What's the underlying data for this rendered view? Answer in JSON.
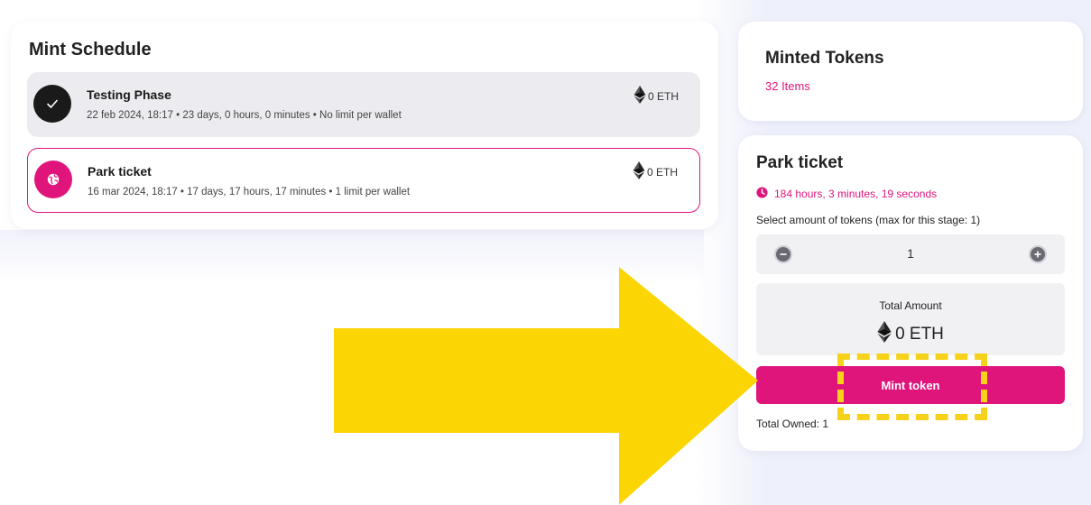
{
  "schedule": {
    "title": "Mint Schedule",
    "phases": [
      {
        "name": "Testing Phase",
        "meta": "22 feb 2024, 18:17  •  23 days, 0 hours, 0 minutes  •  No limit per wallet",
        "price": "0 ETH",
        "icon": "check-icon"
      },
      {
        "name": "Park ticket",
        "meta": "16 mar 2024, 18:17  •  17 days, 17 hours, 17 minutes  •  1 limit per wallet",
        "price": "0 ETH",
        "icon": "globe-icon"
      }
    ]
  },
  "minted": {
    "title": "Minted Tokens",
    "count": "32 Items"
  },
  "ticket": {
    "title": "Park ticket",
    "countdown": "184 hours, 3 minutes, 19 seconds",
    "select_label": "Select amount of tokens (max for this stage: 1)",
    "quantity": "1",
    "total_label": "Total Amount",
    "total_value": "0 ETH",
    "mint_label": "Mint token",
    "owned": "Total Owned: 1"
  },
  "colors": {
    "accent": "#e0157c",
    "highlight": "#f7d21a",
    "dark": "#1a1a1a"
  }
}
